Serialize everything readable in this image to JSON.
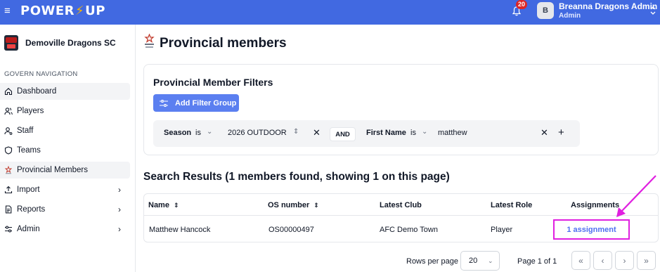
{
  "app": {
    "logo_left": "POWER",
    "logo_right": "UP",
    "menu_glyph": "≡"
  },
  "header": {
    "notification_count": "20",
    "avatar_initial": "B",
    "user_name": "Breanna Dragons Admin",
    "user_role": "Admin",
    "icons": [
      "bell-icon",
      "chevron-updown-icon"
    ]
  },
  "sidebar": {
    "club_name": "Demoville Dragons SC",
    "nav_heading": "GOVERN NAVIGATION",
    "items": [
      {
        "label": "Dashboard",
        "icon": "home-icon",
        "active": true,
        "expandable": false
      },
      {
        "label": "Players",
        "icon": "users-icon",
        "active": false,
        "expandable": false
      },
      {
        "label": "Staff",
        "icon": "user-cog-icon",
        "active": false,
        "expandable": false
      },
      {
        "label": "Teams",
        "icon": "shield-icon",
        "active": false,
        "expandable": false
      },
      {
        "label": "Provincial Members",
        "icon": "provincial-logo-icon",
        "active": true,
        "expandable": false
      },
      {
        "label": "Import",
        "icon": "upload-icon",
        "active": false,
        "expandable": true
      },
      {
        "label": "Reports",
        "icon": "report-icon",
        "active": false,
        "expandable": true
      },
      {
        "label": "Admin",
        "icon": "settings-icon",
        "active": false,
        "expandable": true
      }
    ]
  },
  "page": {
    "title": "Provincial members"
  },
  "filters": {
    "title": "Provincial Member Filters",
    "add_group_label": "Add Filter Group",
    "conditions": [
      {
        "field": "Season",
        "operator": "is",
        "value": "2026 OUTDOOR"
      },
      {
        "field": "First Name",
        "operator": "is",
        "value": "matthew"
      }
    ],
    "joiner": "AND",
    "add_glyph": "+",
    "remove_glyph": "✕"
  },
  "results": {
    "title": "Search Results (1 members found, showing 1 on this page)",
    "columns": [
      "Name",
      "OS number",
      "Latest Club",
      "Latest Role",
      "Assignments"
    ],
    "rows": [
      {
        "name": "Matthew Hancock",
        "os_number": "OS00000497",
        "club": "AFC Demo Town",
        "role": "Player",
        "assignments": "1 assignment"
      }
    ]
  },
  "pagination": {
    "rows_per_page_label": "Rows per page",
    "rows_per_page": "20",
    "page_label": "Page 1 of 1",
    "first": "«",
    "prev": "‹",
    "next": "›",
    "last": "»"
  },
  "colors": {
    "topbar": "#4169e1",
    "primary_button": "#5b7ff0",
    "annotation": "#e020e0",
    "badge": "#dc2626"
  }
}
